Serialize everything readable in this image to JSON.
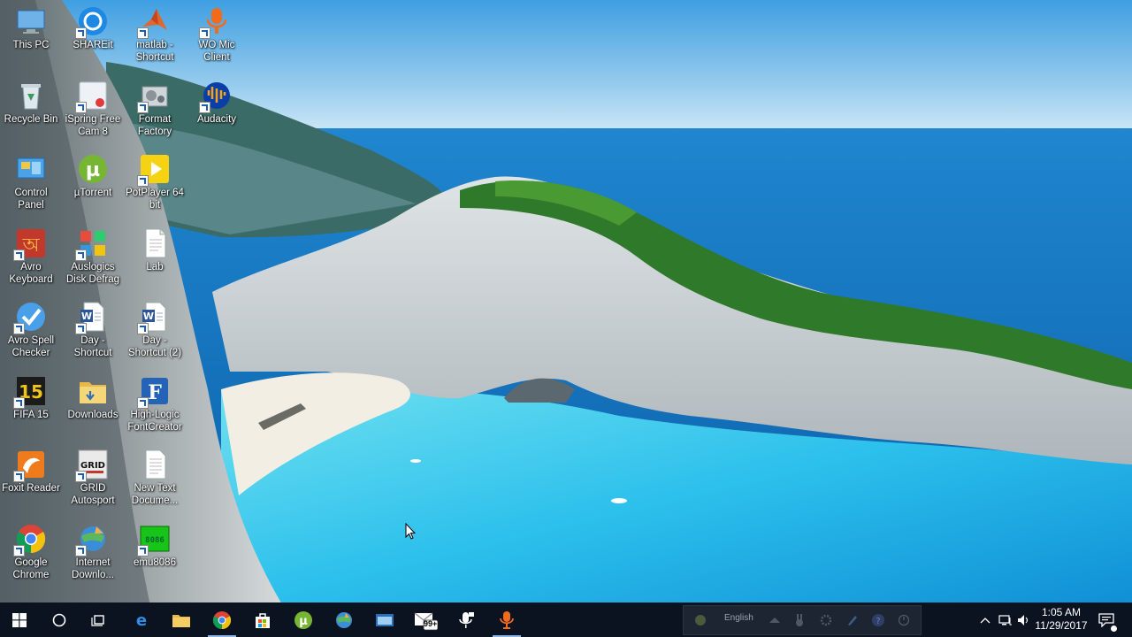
{
  "desktop": {
    "icons": [
      {
        "label": "This PC",
        "icon": "computer-icon"
      },
      {
        "label": "SHAREit",
        "icon": "shareit-icon"
      },
      {
        "label": "matlab -\nShortcut",
        "icon": "matlab-icon"
      },
      {
        "label": "WO Mic\nClient",
        "icon": "microphone-icon"
      },
      {
        "label": "Recycle Bin",
        "icon": "recycle-bin-icon"
      },
      {
        "label": "iSpring Free\nCam 8",
        "icon": "ispring-icon"
      },
      {
        "label": "Format\nFactory",
        "icon": "format-factory-icon"
      },
      {
        "label": "Audacity",
        "icon": "audacity-icon"
      },
      {
        "label": "Control\nPanel",
        "icon": "control-panel-icon"
      },
      {
        "label": "µTorrent",
        "icon": "utorrent-icon"
      },
      {
        "label": "PotPlayer 64\nbit",
        "icon": "potplayer-icon"
      },
      {
        "label": "Avro\nKeyboard",
        "icon": "avro-keyboard-icon"
      },
      {
        "label": "Auslogics\nDisk Defrag",
        "icon": "auslogics-icon"
      },
      {
        "label": "Lab",
        "icon": "file-icon"
      },
      {
        "label": "Avro Spell\nChecker",
        "icon": "spell-check-icon"
      },
      {
        "label": "Day -\nShortcut",
        "icon": "word-doc-icon"
      },
      {
        "label": "Day -\nShortcut (2)",
        "icon": "word-doc-icon"
      },
      {
        "label": "FIFA 15",
        "icon": "fifa-icon"
      },
      {
        "label": "Downloads",
        "icon": "folder-icon"
      },
      {
        "label": "High-Logic\nFontCreator",
        "icon": "fontcreator-icon"
      },
      {
        "label": "Foxit Reader",
        "icon": "foxit-icon"
      },
      {
        "label": "GRID\nAutosport",
        "icon": "grid-autosport-icon"
      },
      {
        "label": "New Text\nDocume...",
        "icon": "text-file-icon"
      },
      {
        "label": "Google\nChrome",
        "icon": "chrome-icon"
      },
      {
        "label": "Internet\nDownlo...",
        "icon": "idm-icon"
      },
      {
        "label": "emu8086",
        "icon": "emu8086-icon"
      }
    ]
  },
  "taskbar": {
    "notification_badge": "99+",
    "language": "English",
    "time": "1:05 AM",
    "date": "11/29/2017"
  },
  "colors": {
    "taskbar_bg": "#0b1220",
    "sky": "#3ea0e3",
    "sea": "#0a6fb8",
    "lagoon": "#2fc0ea"
  }
}
